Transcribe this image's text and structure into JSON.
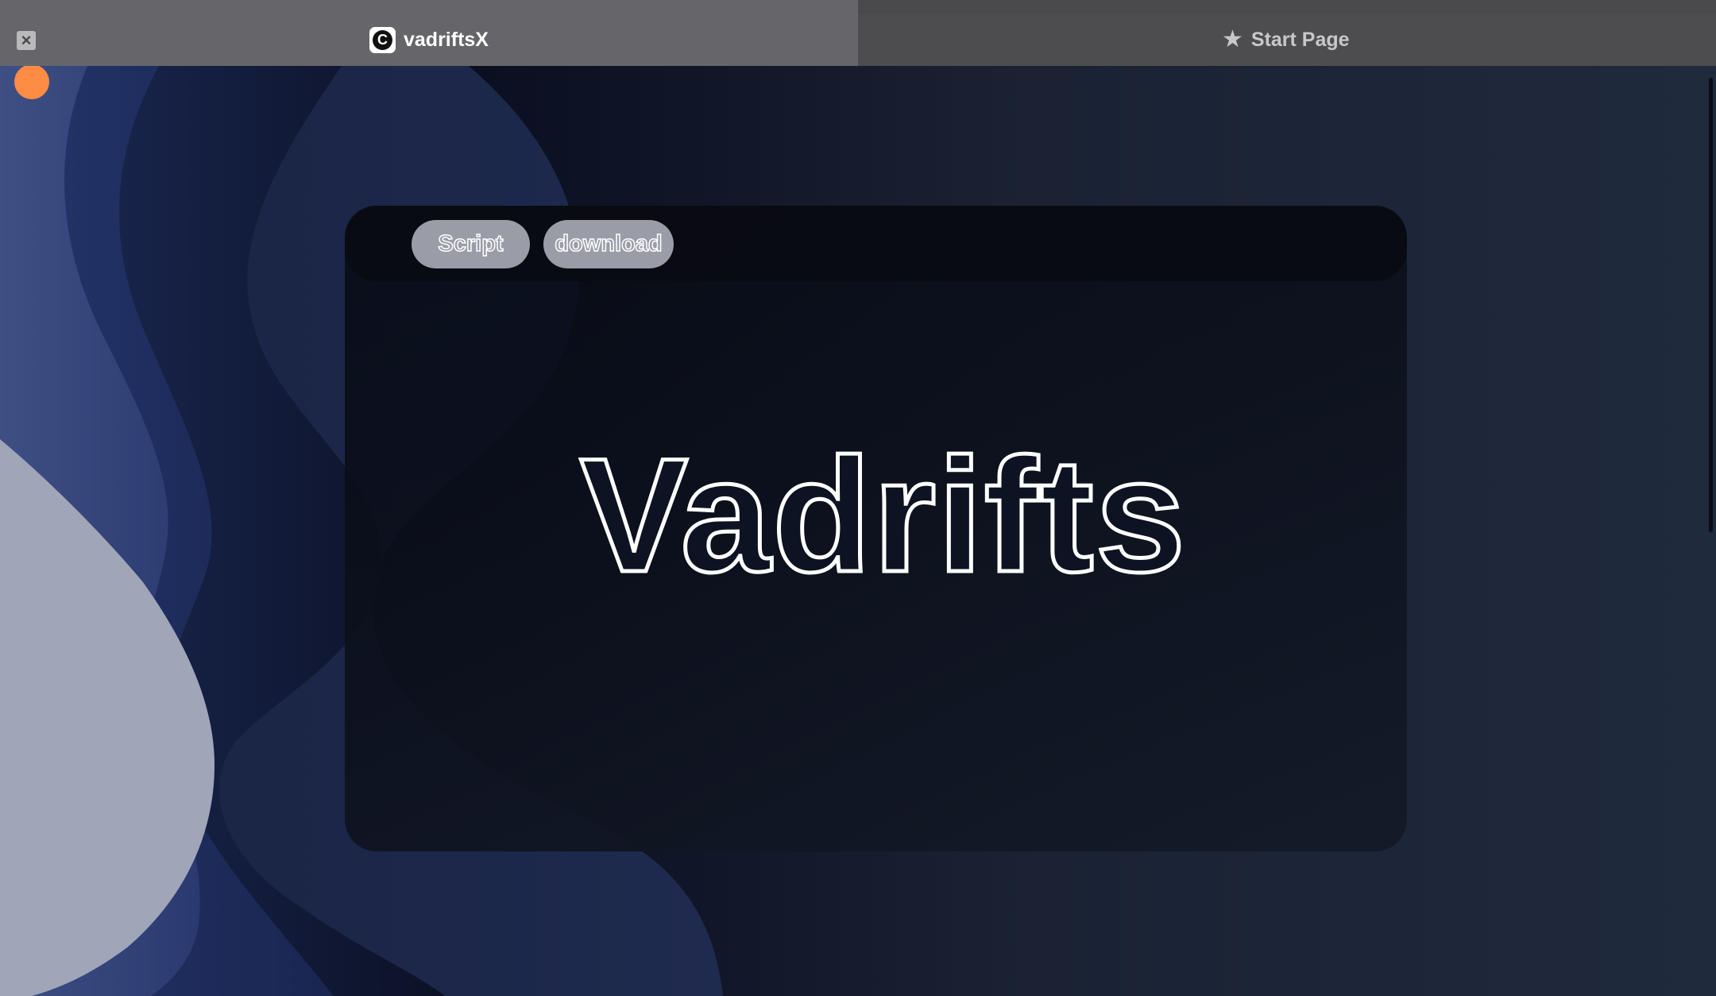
{
  "tabs": [
    {
      "label": "vadriftsX",
      "favicon_glyph": "C",
      "active": true
    },
    {
      "label": "Start Page",
      "icon": "star-icon",
      "active": false
    }
  ],
  "close_icon": "×",
  "star_glyph": "★",
  "colors": {
    "accent_dot": "#ff8c45",
    "background": "#1e2638",
    "pill": "#9a9da8"
  },
  "panel": {
    "buttons": [
      {
        "label": "Script"
      },
      {
        "label": "download"
      }
    ],
    "hero_title": "Vadrifts"
  }
}
